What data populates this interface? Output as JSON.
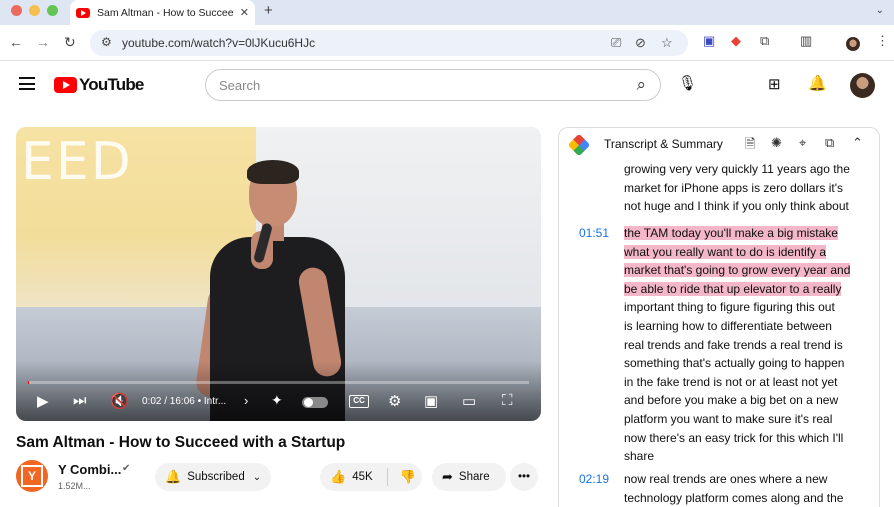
{
  "browser": {
    "tab_title": "Sam Altman - How to Succee",
    "tab_close": "✕",
    "new_tab": "+",
    "url": "youtube.com/watch?v=0lJKucu6HJc"
  },
  "youtube": {
    "logo_text": "YouTube",
    "search_placeholder": "Search"
  },
  "player": {
    "overlay_text": "EED",
    "time": "0:02 / 16:06",
    "chapter": "• Intr...",
    "progress_fraction": 0.002
  },
  "video": {
    "title": "Sam Altman - How to Succeed with a Startup",
    "channel_name": "Y Combi...",
    "channel_initial": "Y",
    "subscribers": "1.52M...",
    "subscribed_label": "Subscribed",
    "likes": "45K",
    "share_label": "Share"
  },
  "transcript": {
    "title": "Transcript & Summary",
    "segments": [
      {
        "time": "",
        "lines": [
          {
            "text": "growing very very quickly 11 years ago the",
            "hl": false
          },
          {
            "text": "market for iPhone apps is zero dollars it's",
            "hl": false
          },
          {
            "text": "not huge and I think if you only think about",
            "hl": false
          }
        ]
      },
      {
        "time": "01:51",
        "lines": [
          {
            "text": "the TAM today you'll make a big mistake",
            "hl": true
          },
          {
            "text": "what you really want to do is identify a",
            "hl": true
          },
          {
            "text": "market that's going to grow every year and",
            "hl": true
          },
          {
            "text": "be able to ride that up elevator to a really",
            "hl": true
          },
          {
            "text": "important thing to figure figuring this out",
            "hl": false
          },
          {
            "text": "is learning how to differentiate between",
            "hl": false
          },
          {
            "text": "real trends and fake trends a real trend is",
            "hl": false
          },
          {
            "text": "something that's actually going to happen",
            "hl": false
          },
          {
            "text": "in the fake trend is not or at least not yet",
            "hl": false
          },
          {
            "text": "and before you make a big bet on a new",
            "hl": false
          },
          {
            "text": "platform you want to make sure it's real",
            "hl": false
          },
          {
            "text": "now there's an easy trick for this which I'll",
            "hl": false
          },
          {
            "text": "share",
            "hl": false
          }
        ]
      },
      {
        "time": "02:19",
        "lines": [
          {
            "text": "now real trends are ones where a new",
            "hl": false
          },
          {
            "text": "technology platform comes along and the",
            "hl": false
          }
        ]
      }
    ]
  },
  "icons": [
    "back-icon",
    "forward-icon",
    "reload-icon",
    "site-settings-icon",
    "cast-icon",
    "eye-off-icon",
    "bookmark-star-icon",
    "extension-icon",
    "gemini-icon",
    "puzzle-icon",
    "reading-list-icon",
    "profile-icon",
    "kebab-menu-icon",
    "hamburger-menu-icon",
    "search-icon",
    "mic-icon",
    "create-icon",
    "bell-icon",
    "play-icon",
    "next-icon",
    "mute-icon",
    "sparkle-icon",
    "chapter-chevron-icon",
    "autoplay-toggle",
    "cc-icon",
    "settings-gear-icon",
    "miniplayer-icon",
    "theater-icon",
    "fullscreen-icon",
    "verified-check-icon",
    "bell-subscribed-icon",
    "chevron-down-icon",
    "thumbs-up-icon",
    "thumbs-down-icon",
    "share-arrow-icon",
    "more-dots-icon",
    "notes-icon",
    "openai-icon",
    "target-icon",
    "copy-icon",
    "collapse-chevron-icon"
  ],
  "colors": {
    "youtube_red": "#ff0000",
    "highlight": "#f4b6c9",
    "timestamp_blue": "#1a73e8",
    "channel_orange": "#f26522"
  }
}
